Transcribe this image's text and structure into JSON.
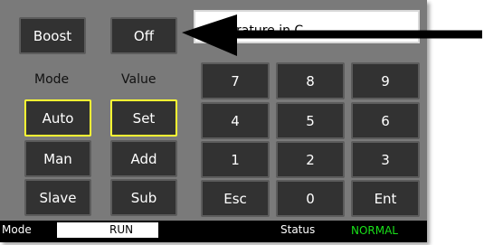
{
  "top_buttons": {
    "boost": "Boost",
    "off": "Off"
  },
  "display": {
    "text": "rature in C     _"
  },
  "labels": {
    "mode": "Mode",
    "value": "Value"
  },
  "mode_buttons": [
    "Auto",
    "Man",
    "Slave"
  ],
  "value_buttons": [
    "Set",
    "Add",
    "Sub"
  ],
  "keypad": [
    "7",
    "8",
    "9",
    "4",
    "5",
    "6",
    "1",
    "2",
    "3",
    "Esc",
    "0",
    "Ent"
  ],
  "status_bar": {
    "mode_label": "Mode",
    "mode_value": "RUN",
    "status_label": "Status",
    "status_value": "NORMAL"
  },
  "colors": {
    "panel": "#7a7a7a",
    "button": "#323232",
    "selected_border": "#ffff33",
    "status_ok": "#19e019"
  }
}
